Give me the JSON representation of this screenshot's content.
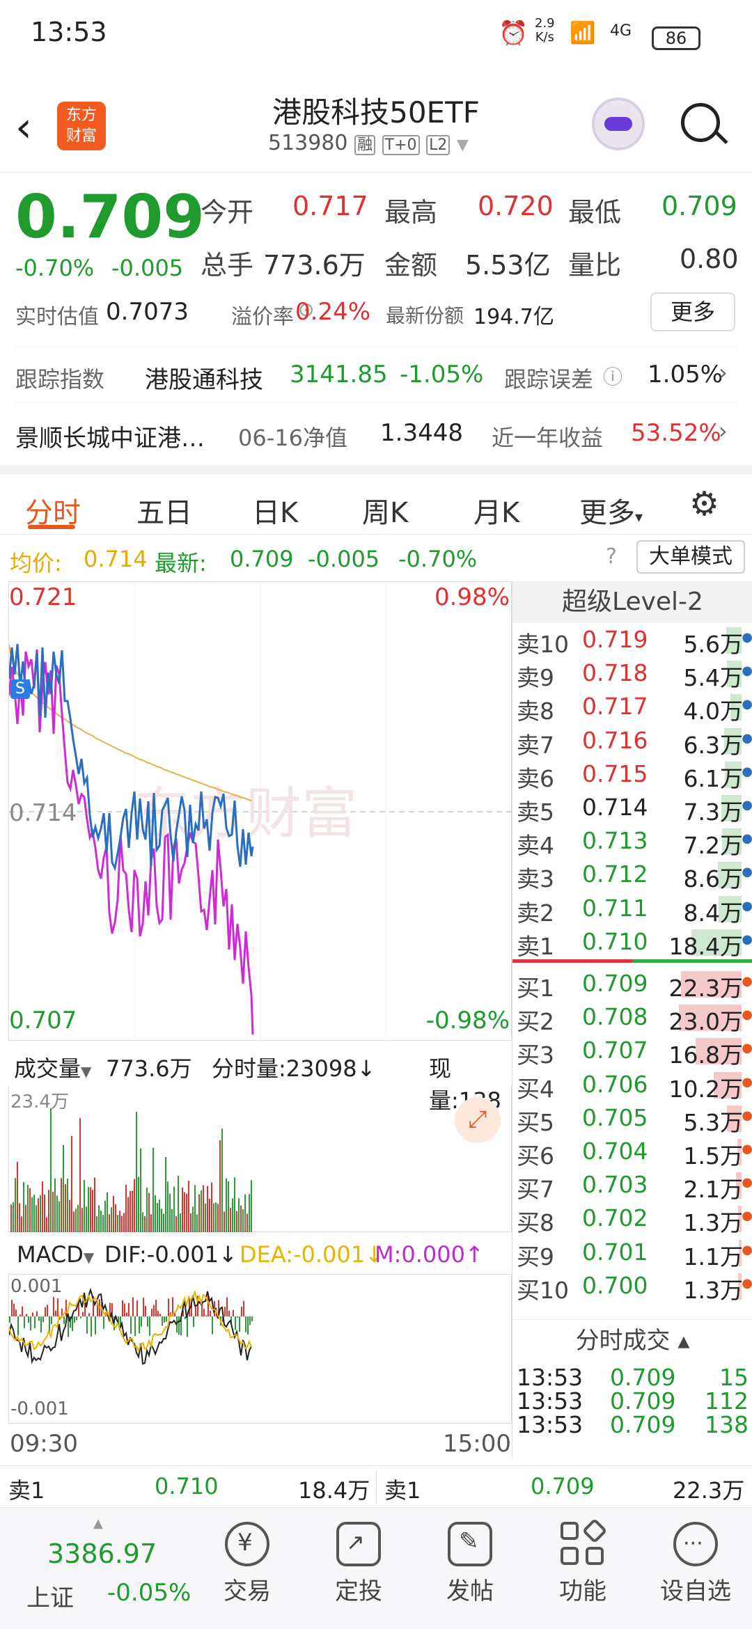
{
  "status": {
    "time": "13:53",
    "speed_top": "2.9",
    "speed_unit": "K/s",
    "signal": "4G",
    "battery": "86"
  },
  "header": {
    "title": "港股科技50ETF",
    "code": "513980",
    "badges": [
      "融",
      "T+0",
      "L2"
    ],
    "logo_text": "东方财富"
  },
  "quote": {
    "price": "0.709",
    "change_pct": "-0.70%",
    "change": "-0.005",
    "open_label": "今开",
    "open": "0.717",
    "high_label": "最高",
    "high": "0.720",
    "low_label": "最低",
    "low": "0.709",
    "vol_label": "总手",
    "vol": "773.6万",
    "amount_label": "金额",
    "amount": "5.53亿",
    "ratio_label": "量比",
    "ratio": "0.80",
    "est_label": "实时估值",
    "est": "0.7073",
    "premium_label": "溢价率",
    "premium": "0.24%",
    "shares_label": "最新份额",
    "shares": "194.7亿",
    "more_btn": "更多",
    "track_label": "跟踪指数",
    "track_name": "港股通科技",
    "track_val": "3141.85",
    "track_pct": "-1.05%",
    "err_label": "跟踪误差",
    "err_val": "1.05%",
    "fund_name": "景顺长城中证港…",
    "nav_label": "06-16净值",
    "nav_val": "1.3448",
    "year_label": "近一年收益",
    "year_val": "53.52%"
  },
  "tabs": [
    "分时",
    "五日",
    "日K",
    "周K",
    "月K",
    "更多"
  ],
  "avgbar": {
    "avg_label": "均价:",
    "avg": "0.714",
    "last_label": "最新:",
    "last": "0.709",
    "chg": "-0.005",
    "pct": "-0.70%",
    "mode_btn": "大单模式"
  },
  "chart": {
    "top_price": "0.721",
    "top_pct": "0.98%",
    "mid_price": "0.714",
    "bot_price": "0.707",
    "bot_pct": "-0.98%",
    "watermark": "东方财富",
    "s_marker": "S",
    "vol_label": "成交量",
    "vol_total": "773.6万",
    "fs_label": "分时量:23098↓",
    "now_label": "现量:138",
    "vol_max": "23.4万",
    "macd_label": "MACD",
    "dif": "DIF:-0.001↓",
    "dea": "DEA:-0.001↓",
    "m": "M:0.000↑",
    "macd_top": "0.001",
    "macd_bot": "-0.001",
    "t_start": "09:30",
    "t_end": "15:00"
  },
  "orderbook": {
    "title": "超级Level-2",
    "asks": [
      [
        "卖10",
        "0.719",
        "5.6万"
      ],
      [
        "卖9",
        "0.718",
        "5.4万"
      ],
      [
        "卖8",
        "0.717",
        "4.0万"
      ],
      [
        "卖7",
        "0.716",
        "6.3万"
      ],
      [
        "卖6",
        "0.715",
        "6.1万"
      ],
      [
        "卖5",
        "0.714",
        "7.3万"
      ],
      [
        "卖4",
        "0.713",
        "7.2万"
      ],
      [
        "卖3",
        "0.712",
        "8.6万"
      ],
      [
        "卖2",
        "0.711",
        "8.4万"
      ],
      [
        "卖1",
        "0.710",
        "18.4万"
      ]
    ],
    "bids": [
      [
        "买1",
        "0.709",
        "22.3万"
      ],
      [
        "买2",
        "0.708",
        "23.0万"
      ],
      [
        "买3",
        "0.707",
        "16.8万"
      ],
      [
        "买4",
        "0.706",
        "10.2万"
      ],
      [
        "买5",
        "0.705",
        "5.3万"
      ],
      [
        "买6",
        "0.704",
        "1.5万"
      ],
      [
        "买7",
        "0.703",
        "2.1万"
      ],
      [
        "买8",
        "0.702",
        "1.3万"
      ],
      [
        "买9",
        "0.701",
        "1.1万"
      ],
      [
        "买10",
        "0.700",
        "1.3万"
      ]
    ],
    "trades_title": "分时成交",
    "trades": [
      [
        "13:53",
        "0.709",
        "15"
      ],
      [
        "13:53",
        "0.709",
        "112"
      ],
      [
        "13:53",
        "0.709",
        "138"
      ]
    ]
  },
  "bottomq": {
    "sell_label": "卖1",
    "sell_price": "0.710",
    "sell_vol": "18.4万",
    "buy_label": "卖1",
    "buy_price": "0.709",
    "buy_vol": "22.3万"
  },
  "nav": {
    "index_val": "3386.97",
    "index_name": "上证",
    "index_pct": "-0.05%",
    "items": [
      "交易",
      "定投",
      "发帖",
      "功能",
      "设自选"
    ]
  }
}
